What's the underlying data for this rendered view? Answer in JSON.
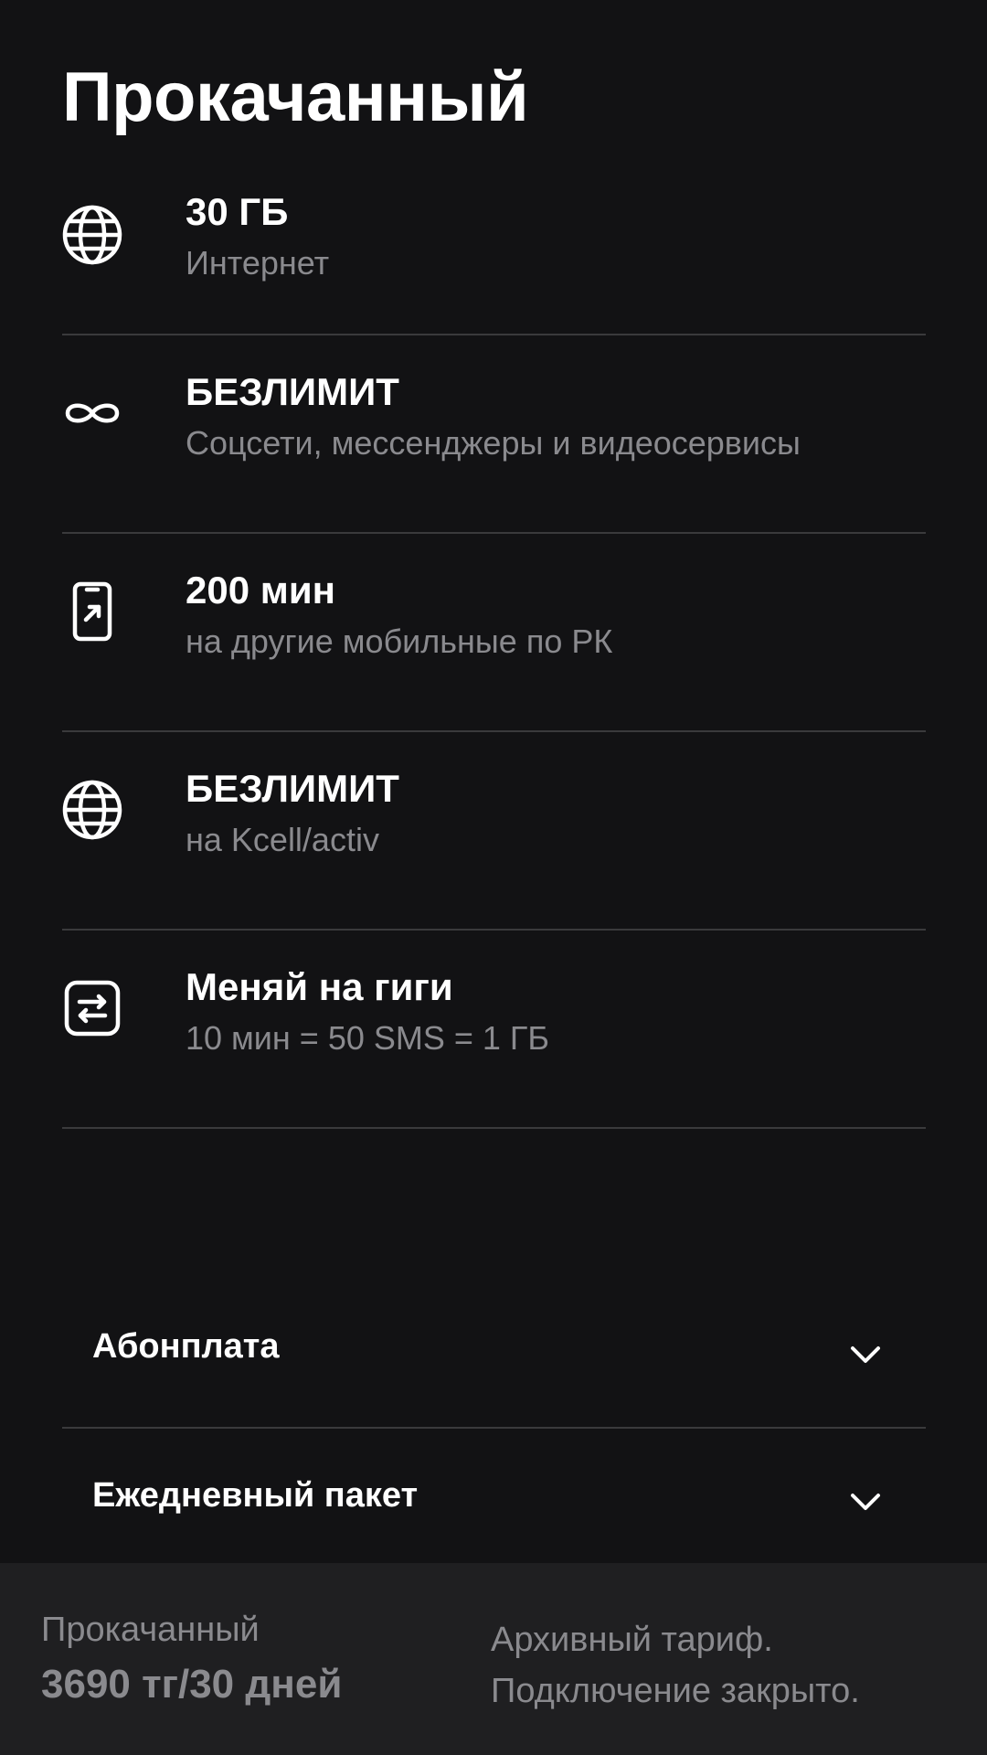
{
  "header": {
    "title": "Прокачанный"
  },
  "features": [
    {
      "icon": "globe-icon",
      "title": "30 ГБ",
      "subtitle": "Интернет"
    },
    {
      "icon": "infinity-icon",
      "title": "БЕЗЛИМИТ",
      "subtitle": "Соцсети, мессенджеры и видеосервисы"
    },
    {
      "icon": "phone-outgoing-icon",
      "title": "200 мин",
      "subtitle": "на другие мобильные по РК"
    },
    {
      "icon": "globe-icon",
      "title": "БЕЗЛИМИТ",
      "subtitle": "на Kcell/activ"
    },
    {
      "icon": "exchange-icon",
      "title": "Меняй на гиги",
      "subtitle": "10 мин = 50 SMS = 1 ГБ"
    }
  ],
  "accordions": [
    {
      "label": "Абонплата",
      "icon": "chevron-down-icon"
    },
    {
      "label": "Ежедневный пакет",
      "icon": "chevron-down-icon"
    }
  ],
  "footer": {
    "tariff_name": "Прокачанный",
    "price": "3690 тг/30 дней",
    "note_line1": "Архивный тариф.",
    "note_line2": "Подключение закрыто."
  },
  "colors": {
    "background": "#121214",
    "footer_background": "#1f1f21",
    "primary_text": "#ffffff",
    "secondary_text": "#8a8a8e",
    "divider": "#3a3a3c"
  }
}
